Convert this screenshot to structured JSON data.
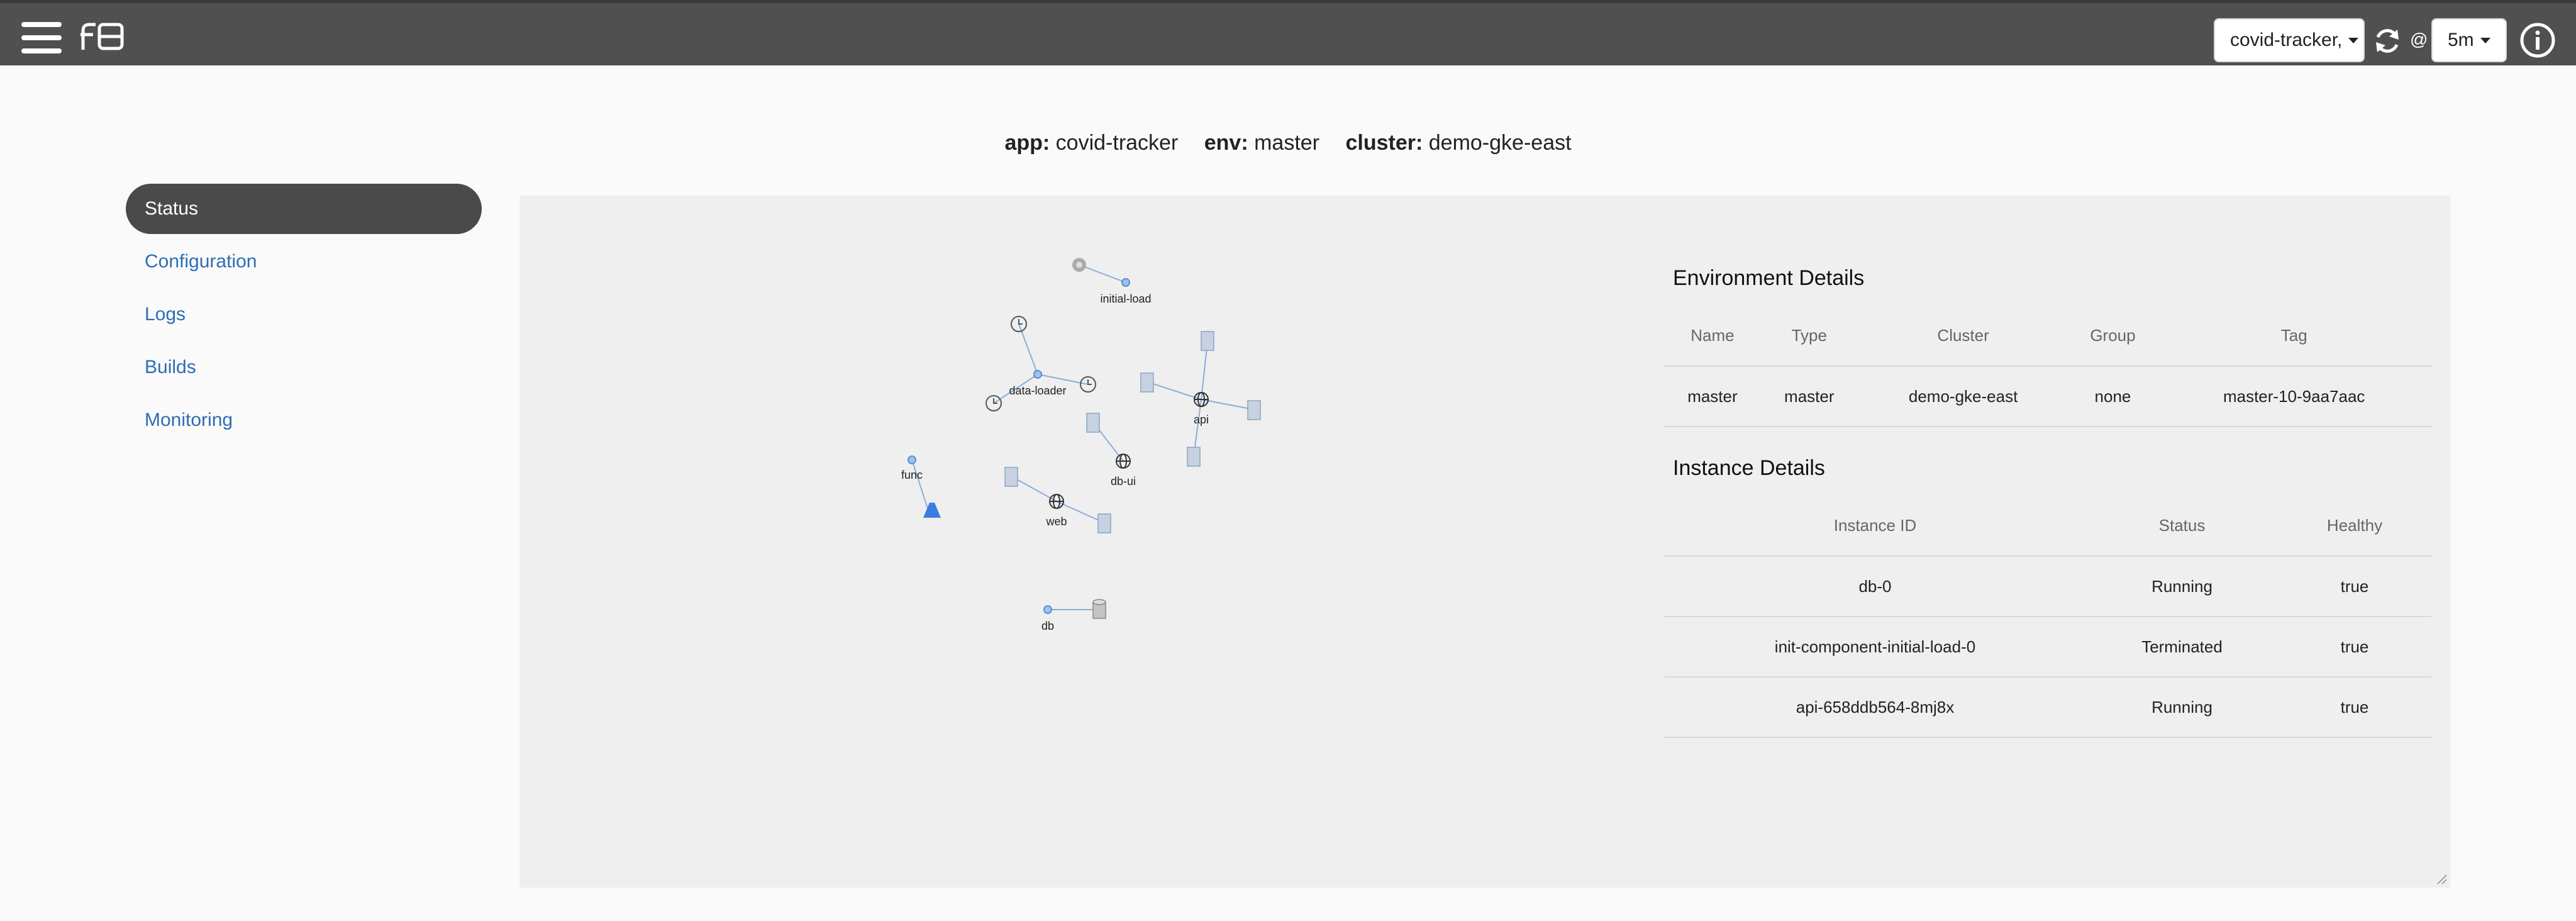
{
  "topbar": {
    "app_select_value": "covid-tracker,",
    "at_sign": "@",
    "interval_value": "5m"
  },
  "context": {
    "app_label": "app:",
    "app_value": "covid-tracker",
    "env_label": "env:",
    "env_value": "master",
    "cluster_label": "cluster:",
    "cluster_value": "demo-gke-east"
  },
  "sidebar": {
    "items": [
      {
        "label": "Status"
      },
      {
        "label": "Configuration"
      },
      {
        "label": "Logs"
      },
      {
        "label": "Builds"
      },
      {
        "label": "Monitoring"
      }
    ]
  },
  "graph": {
    "nodes": {
      "initial_load": "initial-load",
      "data_loader": "data-loader",
      "api": "api",
      "func": "func",
      "db_ui": "db-ui",
      "web": "web",
      "db": "db"
    }
  },
  "environment": {
    "title": "Environment Details",
    "headers": [
      "Name",
      "Type",
      "Cluster",
      "Group",
      "Tag"
    ],
    "rows": [
      [
        "master",
        "master",
        "demo-gke-east",
        "none",
        "master-10-9aa7aac"
      ]
    ]
  },
  "instances": {
    "title": "Instance Details",
    "headers": [
      "Instance ID",
      "Status",
      "Healthy"
    ],
    "rows": [
      [
        "db-0",
        "Running",
        "true"
      ],
      [
        "init-component-initial-load-0",
        "Terminated",
        "true"
      ],
      [
        "api-658ddb564-8mj8x",
        "Running",
        "true"
      ]
    ]
  },
  "colors": {
    "topbar": "#505050",
    "link": "#2d6db5",
    "node_blue": "#6aa2e8",
    "func_icon": "#3b7de0"
  }
}
